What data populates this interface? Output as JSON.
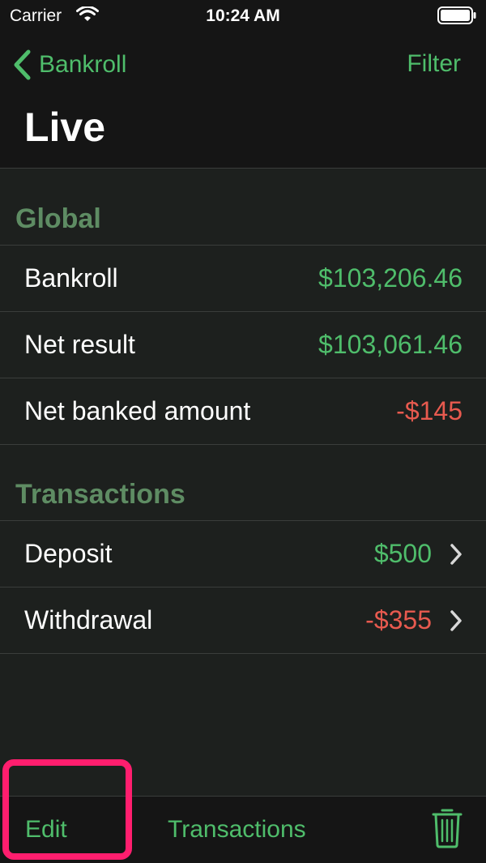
{
  "status_bar": {
    "carrier": "Carrier",
    "time": "10:24 AM"
  },
  "nav": {
    "back_label": "Bankroll",
    "filter_label": "Filter",
    "title": "Live"
  },
  "global": {
    "header": "Global",
    "rows": [
      {
        "label": "Bankroll",
        "value": "$103,206.46"
      },
      {
        "label": "Net result",
        "value": "$103,061.46"
      },
      {
        "label": "Net banked amount",
        "value": "-$145"
      }
    ]
  },
  "transactions": {
    "header": "Transactions",
    "rows": [
      {
        "label": "Deposit",
        "value": "$500"
      },
      {
        "label": "Withdrawal",
        "value": "-$355"
      }
    ]
  },
  "toolbar": {
    "edit_label": "Edit",
    "transactions_label": "Transactions"
  },
  "colors": {
    "accent": "#4fbd6b",
    "negative": "#e85a4f",
    "section_header": "#5e8c63",
    "highlight": "#ff1e6e"
  },
  "icons": [
    "wifi-icon",
    "battery-icon",
    "chevron-left-icon",
    "chevron-right-icon",
    "trash-icon"
  ]
}
